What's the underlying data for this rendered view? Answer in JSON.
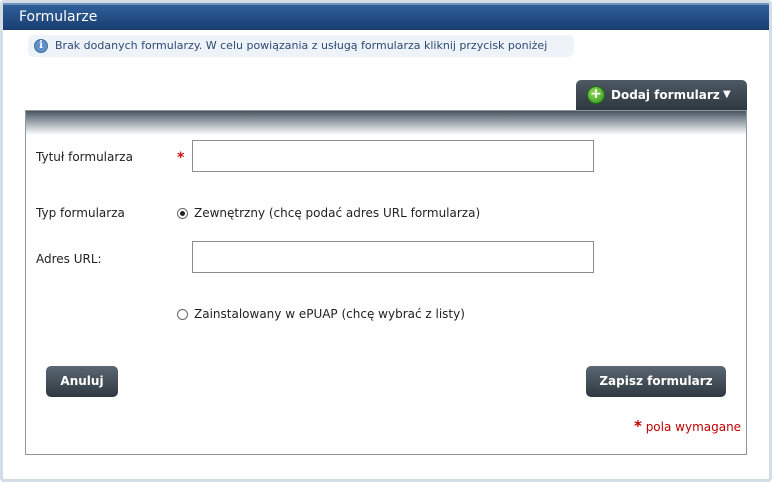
{
  "header": {
    "title": "Formularze"
  },
  "info": {
    "text": "Brak dodanych formularzy. W celu powiązania z usługą formularza kliknij przycisk poniżej"
  },
  "toolbar": {
    "add_label": "Dodaj formularz"
  },
  "form": {
    "title_label": "Tytuł formularza",
    "title_value": "",
    "required_marker": "*",
    "type_label": "Typ formularza",
    "type_options": [
      {
        "label": "Zewnętrzny (chcę podać adres URL formularza)",
        "selected": true
      },
      {
        "label": "Zainstalowany w ePUAP (chcę wybrać z listy)",
        "selected": false
      }
    ],
    "url_label": "Adres URL:",
    "url_value": ""
  },
  "actions": {
    "cancel_label": "Anuluj",
    "save_label": "Zapisz formularz"
  },
  "footer": {
    "required_star": "*",
    "required_text": "pola wymagane"
  },
  "colors": {
    "header_bg": "#1a3e70",
    "button_bg": "#2f3941",
    "required": "#c00000",
    "info_bg": "#eef3f9"
  }
}
